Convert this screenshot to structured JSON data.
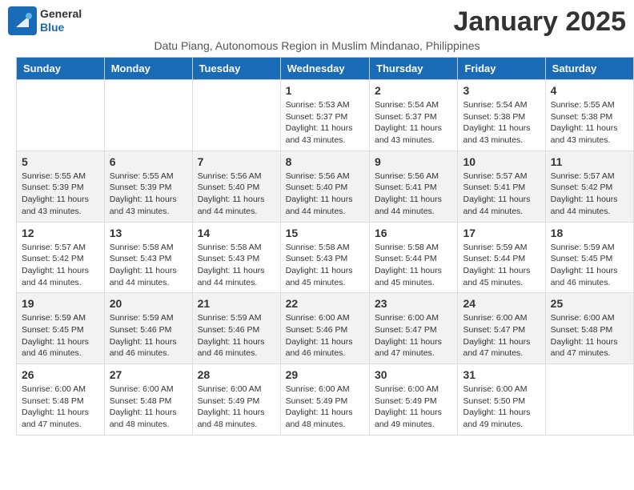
{
  "logo": {
    "general": "General",
    "blue": "Blue"
  },
  "title": "January 2025",
  "subtitle": "Datu Piang, Autonomous Region in Muslim Mindanao, Philippines",
  "days_of_week": [
    "Sunday",
    "Monday",
    "Tuesday",
    "Wednesday",
    "Thursday",
    "Friday",
    "Saturday"
  ],
  "weeks": [
    [
      {
        "num": "",
        "info": ""
      },
      {
        "num": "",
        "info": ""
      },
      {
        "num": "",
        "info": ""
      },
      {
        "num": "1",
        "info": "Sunrise: 5:53 AM\nSunset: 5:37 PM\nDaylight: 11 hours and 43 minutes."
      },
      {
        "num": "2",
        "info": "Sunrise: 5:54 AM\nSunset: 5:37 PM\nDaylight: 11 hours and 43 minutes."
      },
      {
        "num": "3",
        "info": "Sunrise: 5:54 AM\nSunset: 5:38 PM\nDaylight: 11 hours and 43 minutes."
      },
      {
        "num": "4",
        "info": "Sunrise: 5:55 AM\nSunset: 5:38 PM\nDaylight: 11 hours and 43 minutes."
      }
    ],
    [
      {
        "num": "5",
        "info": "Sunrise: 5:55 AM\nSunset: 5:39 PM\nDaylight: 11 hours and 43 minutes."
      },
      {
        "num": "6",
        "info": "Sunrise: 5:55 AM\nSunset: 5:39 PM\nDaylight: 11 hours and 43 minutes."
      },
      {
        "num": "7",
        "info": "Sunrise: 5:56 AM\nSunset: 5:40 PM\nDaylight: 11 hours and 44 minutes."
      },
      {
        "num": "8",
        "info": "Sunrise: 5:56 AM\nSunset: 5:40 PM\nDaylight: 11 hours and 44 minutes."
      },
      {
        "num": "9",
        "info": "Sunrise: 5:56 AM\nSunset: 5:41 PM\nDaylight: 11 hours and 44 minutes."
      },
      {
        "num": "10",
        "info": "Sunrise: 5:57 AM\nSunset: 5:41 PM\nDaylight: 11 hours and 44 minutes."
      },
      {
        "num": "11",
        "info": "Sunrise: 5:57 AM\nSunset: 5:42 PM\nDaylight: 11 hours and 44 minutes."
      }
    ],
    [
      {
        "num": "12",
        "info": "Sunrise: 5:57 AM\nSunset: 5:42 PM\nDaylight: 11 hours and 44 minutes."
      },
      {
        "num": "13",
        "info": "Sunrise: 5:58 AM\nSunset: 5:43 PM\nDaylight: 11 hours and 44 minutes."
      },
      {
        "num": "14",
        "info": "Sunrise: 5:58 AM\nSunset: 5:43 PM\nDaylight: 11 hours and 44 minutes."
      },
      {
        "num": "15",
        "info": "Sunrise: 5:58 AM\nSunset: 5:43 PM\nDaylight: 11 hours and 45 minutes."
      },
      {
        "num": "16",
        "info": "Sunrise: 5:58 AM\nSunset: 5:44 PM\nDaylight: 11 hours and 45 minutes."
      },
      {
        "num": "17",
        "info": "Sunrise: 5:59 AM\nSunset: 5:44 PM\nDaylight: 11 hours and 45 minutes."
      },
      {
        "num": "18",
        "info": "Sunrise: 5:59 AM\nSunset: 5:45 PM\nDaylight: 11 hours and 46 minutes."
      }
    ],
    [
      {
        "num": "19",
        "info": "Sunrise: 5:59 AM\nSunset: 5:45 PM\nDaylight: 11 hours and 46 minutes."
      },
      {
        "num": "20",
        "info": "Sunrise: 5:59 AM\nSunset: 5:46 PM\nDaylight: 11 hours and 46 minutes."
      },
      {
        "num": "21",
        "info": "Sunrise: 5:59 AM\nSunset: 5:46 PM\nDaylight: 11 hours and 46 minutes."
      },
      {
        "num": "22",
        "info": "Sunrise: 6:00 AM\nSunset: 5:46 PM\nDaylight: 11 hours and 46 minutes."
      },
      {
        "num": "23",
        "info": "Sunrise: 6:00 AM\nSunset: 5:47 PM\nDaylight: 11 hours and 47 minutes."
      },
      {
        "num": "24",
        "info": "Sunrise: 6:00 AM\nSunset: 5:47 PM\nDaylight: 11 hours and 47 minutes."
      },
      {
        "num": "25",
        "info": "Sunrise: 6:00 AM\nSunset: 5:48 PM\nDaylight: 11 hours and 47 minutes."
      }
    ],
    [
      {
        "num": "26",
        "info": "Sunrise: 6:00 AM\nSunset: 5:48 PM\nDaylight: 11 hours and 47 minutes."
      },
      {
        "num": "27",
        "info": "Sunrise: 6:00 AM\nSunset: 5:48 PM\nDaylight: 11 hours and 48 minutes."
      },
      {
        "num": "28",
        "info": "Sunrise: 6:00 AM\nSunset: 5:49 PM\nDaylight: 11 hours and 48 minutes."
      },
      {
        "num": "29",
        "info": "Sunrise: 6:00 AM\nSunset: 5:49 PM\nDaylight: 11 hours and 48 minutes."
      },
      {
        "num": "30",
        "info": "Sunrise: 6:00 AM\nSunset: 5:49 PM\nDaylight: 11 hours and 49 minutes."
      },
      {
        "num": "31",
        "info": "Sunrise: 6:00 AM\nSunset: 5:50 PM\nDaylight: 11 hours and 49 minutes."
      },
      {
        "num": "",
        "info": ""
      }
    ]
  ]
}
